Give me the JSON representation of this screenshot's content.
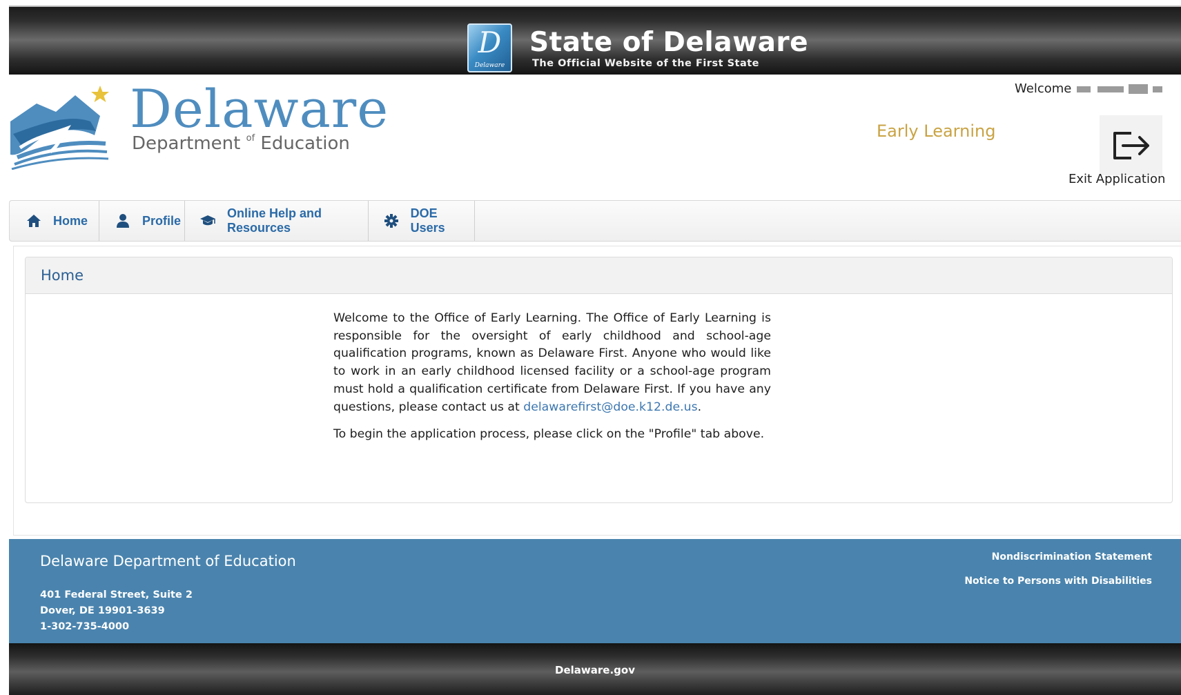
{
  "state_banner": {
    "title": "State of Delaware",
    "subtitle": "The Official Website of the First State",
    "seal_letter": "D",
    "seal_word": "Delaware"
  },
  "header": {
    "logo_name": "Delaware",
    "logo_dept_prefix": "Department ",
    "logo_dept_of": "of",
    "logo_dept_suffix": " Education",
    "welcome_label": "Welcome",
    "app_name": "Early Learning",
    "exit_label": "Exit Application"
  },
  "nav": {
    "items": [
      {
        "label": "Home",
        "icon": "home-icon"
      },
      {
        "label": "Profile",
        "icon": "user-icon"
      },
      {
        "label": "Online Help and Resources",
        "icon": "graduation-cap-icon"
      },
      {
        "label": "DOE Users",
        "icon": "gear-icon"
      }
    ]
  },
  "main": {
    "panel_title": "Home",
    "intro_p1": "Welcome to the Office of Early Learning.  The Office of Early Learning is responsible for the oversight of early childhood and school-age qualification programs, known as Delaware First.  Anyone who would like to work in an early childhood licensed facility or a school-age program must hold a qualification certificate from Delaware First. If you have any questions, please contact us at ",
    "contact_email": "delawarefirst@doe.k12.de.us",
    "intro_p1_end": ".",
    "intro_p2": "To begin the application process, please click on the \"Profile\" tab above."
  },
  "footer": {
    "org_name": "Delaware Department of Education",
    "address_line1": "401 Federal Street, Suite 2",
    "address_line2": "Dover, DE 19901-3639",
    "phone": "1-302-735-4000",
    "links": [
      "Nondiscrimination Statement",
      "Notice to Persons with Disabilities"
    ],
    "bottom_link": "Delaware.gov"
  },
  "colors": {
    "brand_blue": "#4f8dbf",
    "nav_text": "#2a6aa7",
    "early_learning_gold": "#c9a344",
    "footer_blue": "#4a84ae"
  }
}
